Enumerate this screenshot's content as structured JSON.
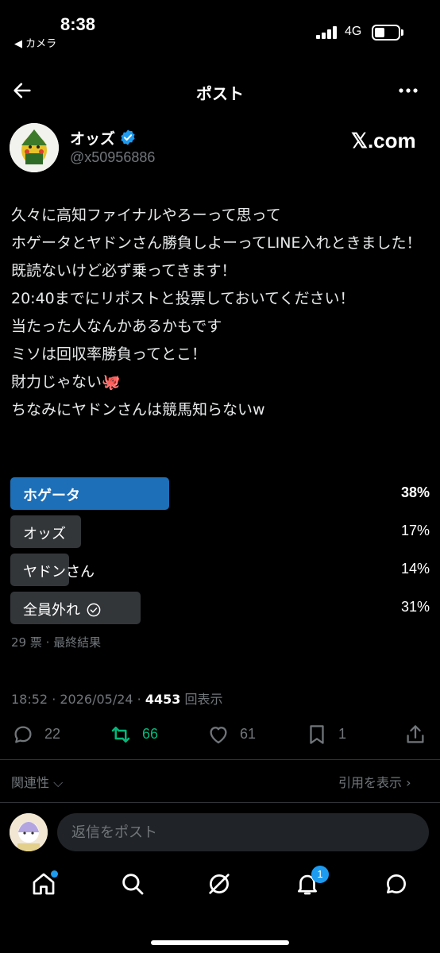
{
  "status_bar": {
    "time": "8:38",
    "back_app": "◀ カメラ",
    "network": "4G"
  },
  "header": {
    "title": "ポスト"
  },
  "author": {
    "name": "オッズ",
    "handle": "@x50956886",
    "site": "𝕏.com"
  },
  "tweet": {
    "text": "久々に高知ファイナルやろーって思って\nホゲータとヤドンさん勝負しよーってLINE入れときました！\n既読ないけど必ず乗ってきます！\n20:40までにリポストと投票しておいてください！\n当たった人なんかあるかもです\nミソは回収率勝負ってとこ！\n財力じゃない🐙\nちなみにヤドンさんは競馬知らないw"
  },
  "poll": {
    "options": [
      {
        "label": "ホゲータ",
        "percent": "38%",
        "share": 0.38,
        "winner": true
      },
      {
        "label": "オッズ",
        "percent": "17%",
        "share": 0.17,
        "winner": false
      },
      {
        "label": "ヤドンさん",
        "percent": "14%",
        "share": 0.14,
        "winner": false
      },
      {
        "label": "全員外れ",
        "percent": "31%",
        "share": 0.31,
        "winner": false,
        "selected": true
      }
    ],
    "meta": "29 票 · 最終結果"
  },
  "timestamp": {
    "time": "18:52 · 2026/05/24 · ",
    "views": "4453",
    "views_label": " 回表示"
  },
  "actions": {
    "replies": "22",
    "reposts": "66",
    "likes": "61",
    "bookmarks": "1"
  },
  "sort": {
    "relevance": "関連性 ⌵",
    "quotes": "引用を表示 ›"
  },
  "reply": {
    "placeholder": "返信をポスト"
  },
  "nav": {
    "notification_count": "1"
  },
  "colors": {
    "accent": "#1d9bf0",
    "poll_winner": "#1d6fb8",
    "repost_green": "#00ba7c",
    "muted": "#71767b"
  }
}
